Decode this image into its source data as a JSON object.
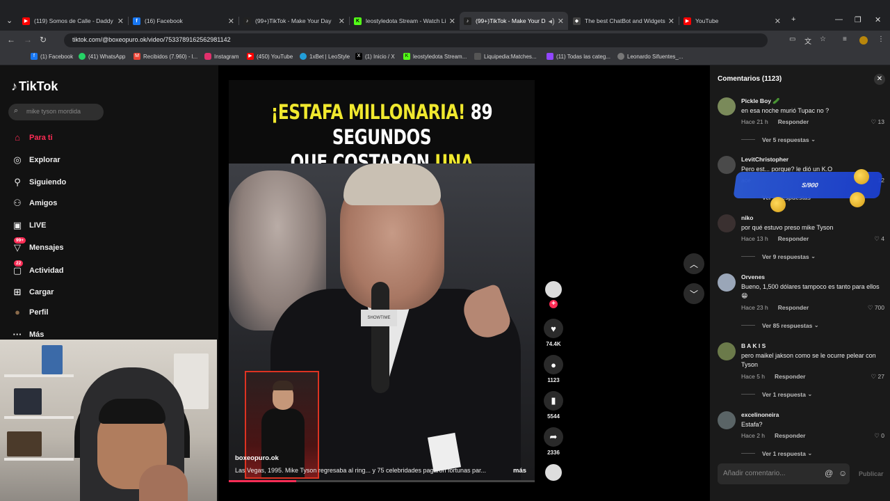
{
  "browser": {
    "tabs": [
      {
        "title": "(119) Somos de Calle - Daddy Y",
        "icon": "youtube-icon",
        "color": "#ff0000"
      },
      {
        "title": "(16) Facebook",
        "icon": "facebook-icon",
        "color": "#1877f2"
      },
      {
        "title": "(99+)TikTok - Make Your Day",
        "icon": "tiktok-icon",
        "color": "#222"
      },
      {
        "title": "leostyledota Stream - Watch Li",
        "icon": "kick-icon",
        "color": "#53fc18"
      },
      {
        "title": "(99+)TikTok - Make Your Da",
        "icon": "tiktok-icon",
        "color": "#222"
      },
      {
        "title": "The best ChatBot and Widgets",
        "icon": "diamond-icon",
        "color": "#444"
      },
      {
        "title": "YouTube",
        "icon": "youtube-icon",
        "color": "#ff0000"
      }
    ],
    "url": "tiktok.com/@boxeopuro.ok/video/7533789162562981142",
    "bookmarks": [
      {
        "label": "(1) Facebook",
        "color": "#1877f2"
      },
      {
        "label": "(41) WhatsApp",
        "color": "#25d366"
      },
      {
        "label": "Recibidos (7.960) - l...",
        "color": "#ea4335"
      },
      {
        "label": "Instagram",
        "color": "#e1306c"
      },
      {
        "label": "(450) YouTube",
        "color": "#ff0000"
      },
      {
        "label": "1xBet | LeoStyle",
        "color": "#229ed9"
      },
      {
        "label": "(1) Inicio / X",
        "color": "#000"
      },
      {
        "label": "leostyledota Stream...",
        "color": "#53fc18"
      },
      {
        "label": "Liquipedia:Matches...",
        "color": "#555"
      },
      {
        "label": "(11) Todas las categ...",
        "color": "#9146ff"
      },
      {
        "label": "Leonardo Sifuentes_...",
        "color": "#777"
      }
    ]
  },
  "tiktok": {
    "logo": "TikTok",
    "search_placeholder": "mike tyson mordida",
    "nav": [
      {
        "label": "Para ti",
        "icon": "home-icon",
        "glyph": "⌂"
      },
      {
        "label": "Explorar",
        "icon": "compass-icon",
        "glyph": "◎"
      },
      {
        "label": "Siguiendo",
        "icon": "following-icon",
        "glyph": "👤"
      },
      {
        "label": "Amigos",
        "icon": "friends-icon",
        "glyph": "👥"
      },
      {
        "label": "LIVE",
        "icon": "live-icon",
        "glyph": "▣"
      },
      {
        "label": "Mensajes",
        "icon": "messages-icon",
        "glyph": "▽",
        "badge": "99+"
      },
      {
        "label": "Actividad",
        "icon": "activity-icon",
        "glyph": "▢",
        "badge": "22"
      },
      {
        "label": "Cargar",
        "icon": "upload-icon",
        "glyph": "⊞"
      },
      {
        "label": "Perfil",
        "icon": "profile-icon",
        "glyph": "●"
      },
      {
        "label": "Más",
        "icon": "more-icon",
        "glyph": "···"
      }
    ]
  },
  "video": {
    "caption_line1_a": "¡ESTAFA MILLONARIA!",
    "caption_line1_b": "89 SEGUNDOS",
    "caption_line2_a": "QUE COSTARON",
    "caption_line2_b": "UNA FORTUNA",
    "author": "boxeopuro.ok",
    "description": "Las Vegas, 1995. Mike Tyson regresaba al ring... y 75 celebridades pagaron fortunas par...",
    "more": "más",
    "progress": 0.22,
    "likes": "74.4K",
    "comments": "1123",
    "saves": "5544",
    "shares": "2336",
    "mic_brand": "SHOWTIME"
  },
  "comments_panel": {
    "title": "Comentarios (1123)",
    "input_placeholder": "Añadir comentario...",
    "publish": "Publicar",
    "ad_text": "S/900",
    "items": [
      {
        "name": "Pickle Boy 🥒",
        "text": "en esa noche murió Tupac no ?",
        "time": "Hace 21 h",
        "reply": "Responder",
        "likes": "13",
        "replies": "Ver 5 respuestas"
      },
      {
        "name": "LevitChristopher",
        "text": "Pero est... porque? le dió un K.O",
        "time": "ace",
        "reply": "",
        "likes": "12",
        "replies": "Ver ... respuestas"
      },
      {
        "name": "niko",
        "text": "por qué estuvo preso mike Tyson",
        "time": "Hace 13 h",
        "reply": "Responder",
        "likes": "4",
        "replies": "Ver 9 respuestas"
      },
      {
        "name": "Orvenes",
        "text": "Bueno, 1,500 dólares tampoco es tanto para ellos 😁",
        "time": "Hace 23 h",
        "reply": "Responder",
        "likes": "700",
        "replies": "Ver 85 respuestas"
      },
      {
        "name": "B A K I S",
        "text": "pero maikel jakson como se le ocurre pelear con Tyson",
        "time": "Hace 5 h",
        "reply": "Responder",
        "likes": "27",
        "replies": "Ver 1 respuesta"
      },
      {
        "name": "excelinoneira",
        "text": "Estafa?",
        "time": "Hace 2 h",
        "reply": "Responder",
        "likes": "0",
        "replies": "Ver 1 respuesta"
      }
    ]
  }
}
